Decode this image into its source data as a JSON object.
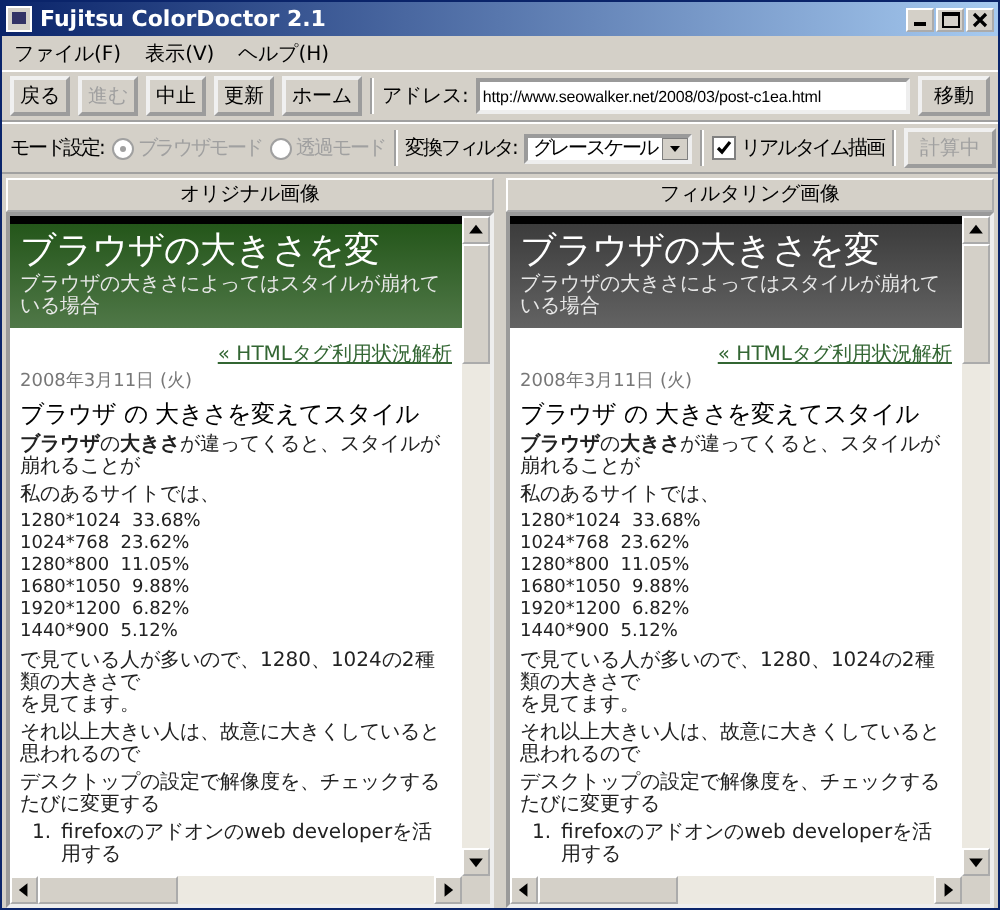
{
  "window": {
    "title": "Fujitsu ColorDoctor 2.1"
  },
  "menu": [
    "ファイル(F)",
    "表示(V)",
    "ヘルプ(H)"
  ],
  "toolbar": [
    {
      "label": "戻る",
      "disabled": false
    },
    {
      "label": "進む",
      "disabled": true
    },
    {
      "label": "中止",
      "disabled": false
    },
    {
      "label": "更新",
      "disabled": false
    },
    {
      "label": "ホーム",
      "disabled": false
    }
  ],
  "address": {
    "label": "アドレス:",
    "value": "http://www.seowalker.net/2008/03/post-c1ea.html",
    "button": "移動"
  },
  "mode": {
    "label": "モード設定:",
    "options": [
      {
        "label": "ブラウザモード",
        "selected": true,
        "disabled": true
      },
      {
        "label": "透過モード",
        "selected": false,
        "disabled": true
      }
    ]
  },
  "filter": {
    "label": "変換フィルタ:",
    "value": "グレースケール"
  },
  "realtime": {
    "label": "リアルタイム描画",
    "checked": true
  },
  "compute_button": {
    "label": "計算中",
    "disabled": true
  },
  "panes": [
    {
      "title": "オリジナル画像",
      "color": "#24561a",
      "banner_title": "ブラウザの大きさを変",
      "banner_subtitle": "ブラウザの大きさによってはスタイルが崩れている場合",
      "nav_link": "« HTMLタグ利用状況解析",
      "date": "2008年3月11日 (火)",
      "heading": "ブラウザ の 大きさを変えてスタイル",
      "intro": "**ブラウザ**の**大きさ**が違ってくると、スタイルが崩れることが",
      "site_line": "私のあるサイトでは、",
      "stats": [
        "1280*1024  33.68%",
        "1024*768  23.62%",
        "1280*800  11.05%",
        "1680*1050  9.88%",
        "1920*1200  6.82%",
        "1440*900  5.12%"
      ],
      "paragraph_lines": [
        "で見ている人が多いので、1280、1024の2種類の大きさで",
        "を見てます。"
      ],
      "paragraphs": [
        "それ以上大きい人は、故意に大きくしていると思われるので",
        "デスクトップの設定で解像度を、チェックするたびに変更する"
      ],
      "list": [
        {
          "number": "1.",
          "text": "firefoxのアドオンのweb developerを活用する"
        }
      ]
    },
    {
      "title": "フィルタリング画像",
      "color": "#3c3c3c",
      "banner_title": "ブラウザの大きさを変",
      "banner_subtitle": "ブラウザの大きさによってはスタイルが崩れている場合",
      "nav_link": "« HTMLタグ利用状況解析",
      "date": "2008年3月11日 (火)",
      "heading": "ブラウザ の 大きさを変えてスタイル",
      "intro": "**ブラウザ**の**大きさ**が違ってくると、スタイルが崩れることが",
      "site_line": "私のあるサイトでは、",
      "stats": [
        "1280*1024  33.68%",
        "1024*768  23.62%",
        "1280*800  11.05%",
        "1680*1050  9.88%",
        "1920*1200  6.82%",
        "1440*900  5.12%"
      ],
      "paragraph_lines": [
        "で見ている人が多いので、1280、1024の2種類の大きさで",
        "を見てます。"
      ],
      "paragraphs": [
        "それ以上大きい人は、故意に大きくしていると思われるので",
        "デスクトップの設定で解像度を、チェックするたびに変更する"
      ],
      "list": [
        {
          "number": "1.",
          "text": "firefoxのアドオンのweb developerを活用する"
        }
      ]
    }
  ]
}
